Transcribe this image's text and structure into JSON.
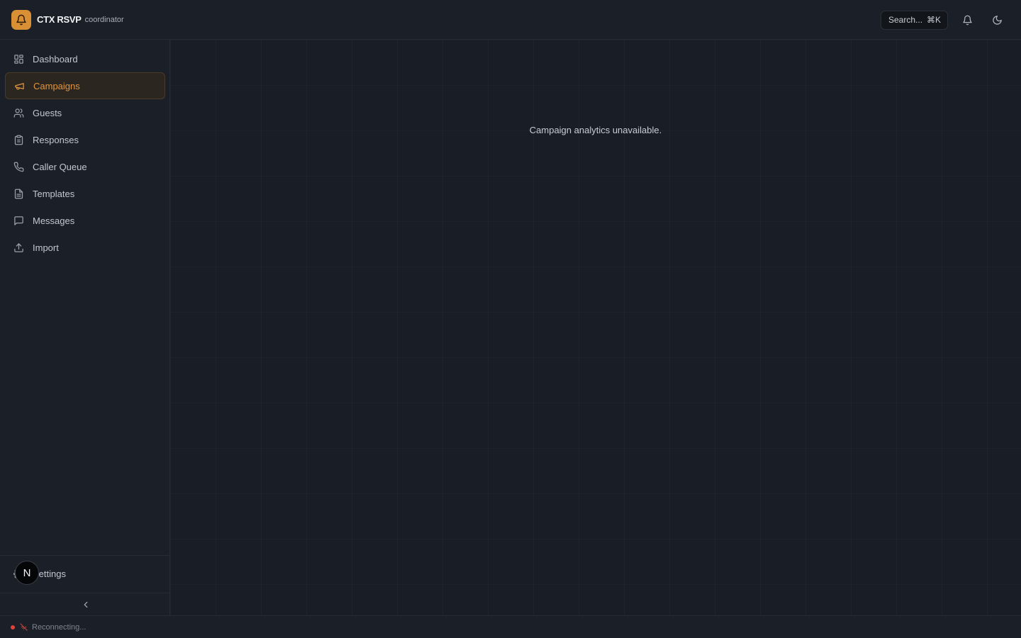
{
  "app": {
    "name": "CTX RSVP",
    "role": "coordinator",
    "logo_icon": "bell-icon",
    "accent_color": "#d98f34"
  },
  "header": {
    "search_label": "Search...",
    "search_shortcut": "⌘K",
    "notifications_icon": "bell-icon",
    "theme_icon": "moon-icon"
  },
  "sidebar": {
    "items": [
      {
        "label": "Dashboard",
        "icon": "grid-icon"
      },
      {
        "label": "Campaigns",
        "icon": "megaphone-icon",
        "active": true
      },
      {
        "label": "Guests",
        "icon": "users-icon"
      },
      {
        "label": "Responses",
        "icon": "clipboard-icon"
      },
      {
        "label": "Caller Queue",
        "icon": "phone-icon"
      },
      {
        "label": "Templates",
        "icon": "file-text-icon"
      },
      {
        "label": "Messages",
        "icon": "message-square-icon"
      },
      {
        "label": "Import",
        "icon": "upload-icon"
      }
    ],
    "settings_label": "Settings",
    "settings_icon": "gear-icon",
    "avatar_initial": "N",
    "collapse_icon": "chevron-left-icon"
  },
  "main": {
    "empty_message": "Campaign analytics unavailable."
  },
  "status": {
    "text": "Reconnecting...",
    "dot_color": "#e0423b",
    "icon": "wifi-off-icon"
  }
}
